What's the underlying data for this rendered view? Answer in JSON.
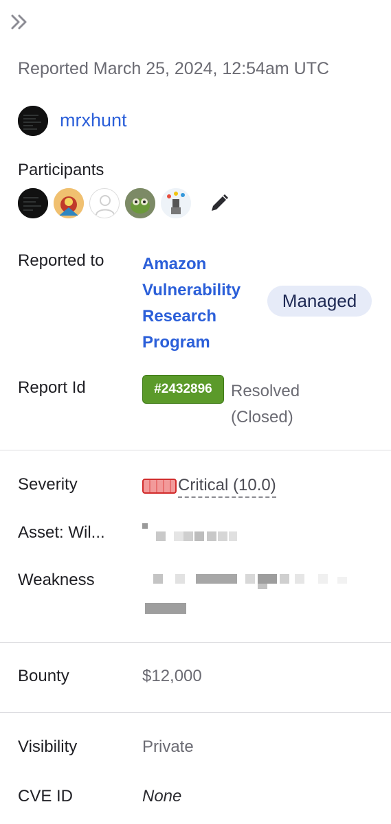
{
  "header": {
    "collapse_icon": "double-chevron-right-icon"
  },
  "report": {
    "reported_at": "Reported March 25, 2024, 12:54am UTC",
    "reporter": {
      "name": "mrxhunt"
    }
  },
  "participants": {
    "label": "Participants",
    "edit_icon": "pencil-icon"
  },
  "reported_to": {
    "label": "Reported to",
    "program": "Amazon Vulnerability Research Program",
    "badge": "Managed"
  },
  "report_id": {
    "label": "Report Id",
    "id": "#2432896",
    "status": "Resolved (Closed)"
  },
  "severity": {
    "label": "Severity",
    "value": "Critical (10.0)",
    "color": "#d12c2c"
  },
  "asset": {
    "label": "Asset: Wil..."
  },
  "weakness": {
    "label": "Weakness"
  },
  "bounty": {
    "label": "Bounty",
    "value": "$12,000"
  },
  "visibility": {
    "label": "Visibility",
    "value": "Private"
  },
  "cve": {
    "label": "CVE ID",
    "value": "None"
  },
  "colors": {
    "link": "#2b5fd9",
    "badge_bg": "#e6ebf8",
    "report_id_bg": "#5b9a2a"
  }
}
